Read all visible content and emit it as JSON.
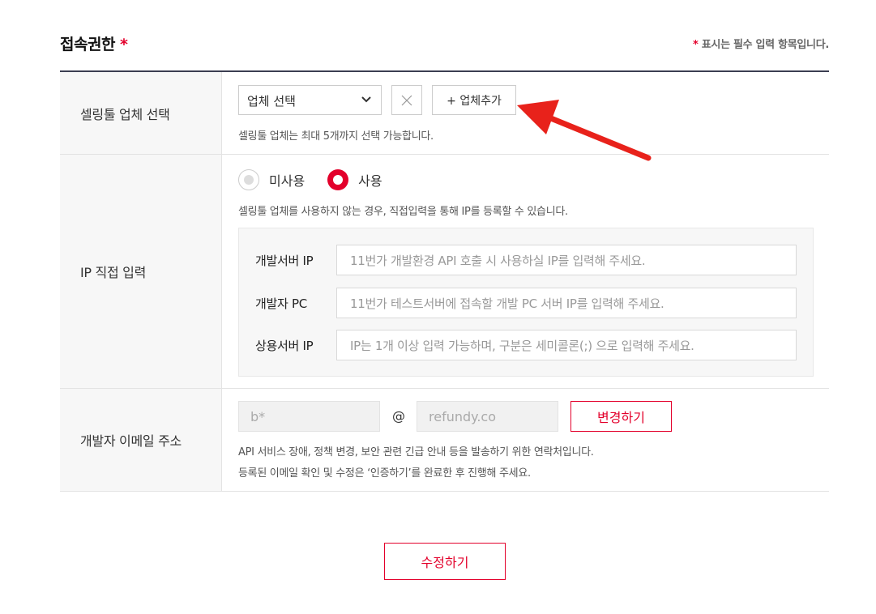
{
  "header": {
    "title": "접속권한",
    "title_star": "*",
    "required_star": "*",
    "required_note": "표시는 필수 입력 항목입니다."
  },
  "vendor": {
    "label": "셀링툴 업체 선택",
    "select_value": "업체 선택",
    "add_label": "+ 업체추가",
    "help": "셀링툴 업체는 최대 5개까지 선택 가능합니다."
  },
  "ip": {
    "label": "IP 직접 입력",
    "radio_off_label": "미사용",
    "radio_on_label": "사용",
    "selected": "사용",
    "help": "셀링툴 업체를 사용하지 않는 경우, 직접입력을 통해 IP를 등록할 수 있습니다.",
    "fields": [
      {
        "name": "개발서버 IP",
        "placeholder": "11번가 개발환경 API 호출 시 사용하실 IP를 입력해 주세요."
      },
      {
        "name": "개발자 PC",
        "placeholder": "11번가 테스트서버에 접속할 개발 PC 서버 IP를 입력해 주세요."
      },
      {
        "name": "상용서버 IP",
        "placeholder": "IP는 1개 이상 입력 가능하며, 구분은 세미콜론(;) 으로 입력해 주세요."
      }
    ]
  },
  "email": {
    "label": "개발자 이메일 주소",
    "local": "b*",
    "at": "@",
    "domain": "refundy.co",
    "change_label": "변경하기",
    "help1": "API 서비스 장애, 정책 변경, 보안 관련 긴급 안내 등을 발송하기 위한 연락처입니다.",
    "help2": "등록된 이메일 확인 및 수정은 ‘인증하기’를 완료한 후 진행해 주세요."
  },
  "submit_label": "수정하기",
  "colors": {
    "accent": "#e3002b",
    "annotation_arrow": "#e8221b"
  }
}
